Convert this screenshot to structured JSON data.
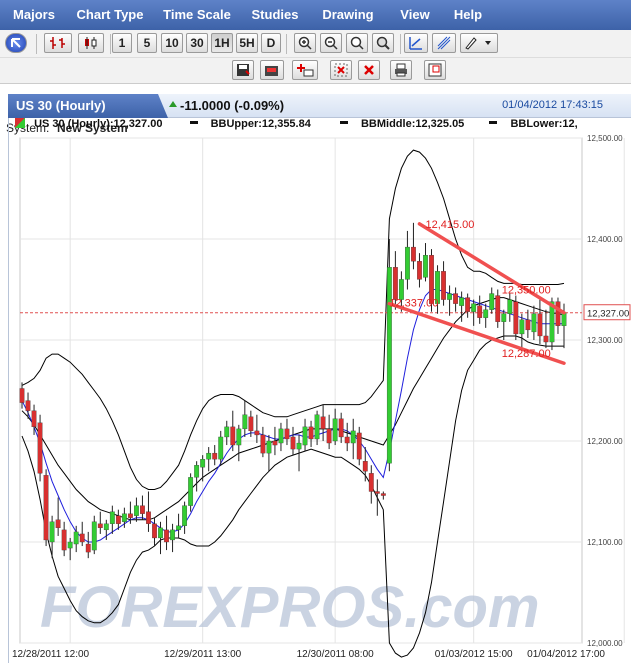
{
  "menu": [
    "Majors",
    "Chart Type",
    "Time Scale",
    "Studies",
    "Drawing",
    "View",
    "Help"
  ],
  "timescale_buttons": [
    "1",
    "5",
    "10",
    "30",
    "1H",
    "5H",
    "D"
  ],
  "timescale_selected": "1H",
  "system": {
    "label": "System:",
    "value": "New System"
  },
  "tab": {
    "title": "US 30 (Hourly)",
    "change": "-11.0000 (-0.09%)",
    "datetime": "01/04/2012 17:43:15"
  },
  "legend": {
    "price": "US 30 (Hourly):12,327.00",
    "bbupper": "BBUpper:12,355.84",
    "bbmiddle": "BBMiddle:12,325.05",
    "bblower": "BBLower:12,"
  },
  "watermark": "FOREXPROS.com",
  "colors": {
    "up": "#33cc33",
    "down": "#d83030",
    "bb": "#000000",
    "ma": "#1f1fdd",
    "trend": "#f05050",
    "text_red": "#e02020",
    "accent": "#3d62a8"
  },
  "chart_data": {
    "type": "candlestick",
    "ylim": [
      12000,
      12500
    ],
    "yticks": [
      12000,
      12100,
      12200,
      12300,
      12400,
      12500
    ],
    "ytick_labels": [
      "12,000.00",
      "12,100.00",
      "12,200.00",
      "12,300.00",
      "12,400.00",
      "12,500.00"
    ],
    "x_labels": [
      {
        "i": 8,
        "label": "12/28/2011 12:00"
      },
      {
        "i": 30,
        "label": "12/29/2011 13:00"
      },
      {
        "i": 52,
        "label": "12/30/2011 08:00"
      },
      {
        "i": 75,
        "label": "01/03/2012 15:00"
      },
      {
        "i": 100,
        "label": "01/04/2012 17:00"
      }
    ],
    "last_price": 12327,
    "last_price_label": "12,327.00",
    "candles": [
      [
        12252,
        12258,
        12232,
        12238
      ],
      [
        12240,
        12248,
        12222,
        12230
      ],
      [
        12230,
        12236,
        12206,
        12214
      ],
      [
        12218,
        12226,
        12160,
        12168
      ],
      [
        12166,
        12172,
        12096,
        12102
      ],
      [
        12100,
        12126,
        12084,
        12120
      ],
      [
        12122,
        12144,
        12106,
        12114
      ],
      [
        12112,
        12120,
        12086,
        12092
      ],
      [
        12094,
        12104,
        12082,
        12100
      ],
      [
        12098,
        12116,
        12090,
        12110
      ],
      [
        12108,
        12120,
        12096,
        12100
      ],
      [
        12098,
        12110,
        12084,
        12090
      ],
      [
        12092,
        12126,
        12088,
        12120
      ],
      [
        12118,
        12130,
        12108,
        12114
      ],
      [
        12112,
        12122,
        12102,
        12118
      ],
      [
        12118,
        12136,
        12108,
        12130
      ],
      [
        12126,
        12132,
        12112,
        12118
      ],
      [
        12120,
        12134,
        12114,
        12128
      ],
      [
        12128,
        12140,
        12118,
        12124
      ],
      [
        12126,
        12144,
        12120,
        12136
      ],
      [
        12136,
        12146,
        12122,
        12128
      ],
      [
        12130,
        12150,
        12110,
        12118
      ],
      [
        12118,
        12124,
        12096,
        12104
      ],
      [
        12104,
        12120,
        12088,
        12114
      ],
      [
        12112,
        12126,
        12092,
        12100
      ],
      [
        12102,
        12118,
        12090,
        12112
      ],
      [
        12112,
        12128,
        12104,
        12116
      ],
      [
        12116,
        12140,
        12108,
        12136
      ],
      [
        12136,
        12168,
        12130,
        12164
      ],
      [
        12164,
        12180,
        12150,
        12176
      ],
      [
        12174,
        12186,
        12160,
        12182
      ],
      [
        12182,
        12194,
        12170,
        12188
      ],
      [
        12188,
        12196,
        12176,
        12182
      ],
      [
        12182,
        12210,
        12176,
        12204
      ],
      [
        12204,
        12220,
        12196,
        12214
      ],
      [
        12214,
        12230,
        12190,
        12196
      ],
      [
        12196,
        12216,
        12180,
        12212
      ],
      [
        12212,
        12240,
        12204,
        12226
      ],
      [
        12224,
        12230,
        12204,
        12210
      ],
      [
        12210,
        12226,
        12198,
        12206
      ],
      [
        12206,
        12214,
        12184,
        12188
      ],
      [
        12188,
        12206,
        12170,
        12200
      ],
      [
        12200,
        12214,
        12186,
        12196
      ],
      [
        12198,
        12218,
        12190,
        12212
      ],
      [
        12212,
        12222,
        12196,
        12202
      ],
      [
        12204,
        12214,
        12186,
        12192
      ],
      [
        12192,
        12206,
        12170,
        12198
      ],
      [
        12196,
        12222,
        12190,
        12214
      ],
      [
        12214,
        12220,
        12194,
        12202
      ],
      [
        12202,
        12230,
        12196,
        12226
      ],
      [
        12224,
        12236,
        12200,
        12212
      ],
      [
        12212,
        12226,
        12192,
        12198
      ],
      [
        12200,
        12232,
        12196,
        12222
      ],
      [
        12222,
        12228,
        12198,
        12204
      ],
      [
        12204,
        12218,
        12190,
        12198
      ],
      [
        12198,
        12222,
        12182,
        12210
      ],
      [
        12208,
        12214,
        12176,
        12182
      ],
      [
        12180,
        12194,
        12160,
        12170
      ],
      [
        12168,
        12176,
        12138,
        12150
      ],
      [
        12150,
        12162,
        12126,
        12148
      ],
      [
        12148,
        12150,
        12142,
        12146
      ],
      [
        12178,
        12400,
        12170,
        12372
      ],
      [
        12372,
        12388,
        12330,
        12340
      ],
      [
        12340,
        12368,
        12328,
        12360
      ],
      [
        12360,
        12408,
        12350,
        12392
      ],
      [
        12392,
        12416,
        12370,
        12378
      ],
      [
        12378,
        12386,
        12352,
        12360
      ],
      [
        12362,
        12396,
        12358,
        12384
      ],
      [
        12384,
        12390,
        12328,
        12336
      ],
      [
        12336,
        12374,
        12326,
        12368
      ],
      [
        12368,
        12378,
        12334,
        12340
      ],
      [
        12340,
        12354,
        12324,
        12346
      ],
      [
        12346,
        12352,
        12328,
        12336
      ],
      [
        12334,
        12348,
        12318,
        12342
      ],
      [
        12342,
        12346,
        12322,
        12328
      ],
      [
        12328,
        12340,
        12314,
        12336
      ],
      [
        12334,
        12344,
        12316,
        12322
      ],
      [
        12322,
        12336,
        12312,
        12330
      ],
      [
        12330,
        12352,
        12326,
        12346
      ],
      [
        12344,
        12350,
        12312,
        12318
      ],
      [
        12318,
        12330,
        12300,
        12326
      ],
      [
        12326,
        12346,
        12318,
        12340
      ],
      [
        12338,
        12344,
        12300,
        12306
      ],
      [
        12306,
        12326,
        12292,
        12320
      ],
      [
        12320,
        12330,
        12302,
        12310
      ],
      [
        12308,
        12334,
        12300,
        12326
      ],
      [
        12326,
        12340,
        12296,
        12304
      ],
      [
        12304,
        12330,
        12292,
        12298
      ],
      [
        12298,
        12342,
        12290,
        12338
      ],
      [
        12338,
        12342,
        12306,
        12314
      ],
      [
        12314,
        12336,
        12292,
        12327
      ]
    ],
    "bb_upper": [
      12255,
      12258,
      12262,
      12270,
      12282,
      12286,
      12286,
      12282,
      12278,
      12272,
      12266,
      12258,
      12250,
      12242,
      12232,
      12220,
      12206,
      12190,
      12174,
      12162,
      12155,
      12152,
      12152,
      12154,
      12160,
      12168,
      12176,
      12190,
      12206,
      12220,
      12232,
      12240,
      12244,
      12246,
      12246,
      12246,
      12244,
      12240,
      12236,
      12232,
      12228,
      12226,
      12224,
      12224,
      12224,
      12226,
      12228,
      12230,
      12232,
      12234,
      12236,
      12236,
      12236,
      12236,
      12236,
      12236,
      12236,
      12238,
      12244,
      12252,
      12260,
      12420,
      12450,
      12470,
      12482,
      12488,
      12486,
      12480,
      12470,
      12456,
      12440,
      12420,
      12400,
      12384,
      12372,
      12368,
      12368,
      12366,
      12362,
      12358,
      12356,
      12356,
      12356,
      12355,
      12355,
      12355,
      12355,
      12355,
      12355,
      12355,
      12356
    ],
    "bb_middle": [
      12230,
      12224,
      12216,
      12206,
      12196,
      12186,
      12176,
      12168,
      12160,
      12152,
      12146,
      12140,
      12136,
      12132,
      12130,
      12128,
      12126,
      12124,
      12122,
      12122,
      12122,
      12122,
      12124,
      12128,
      12132,
      12136,
      12140,
      12146,
      12152,
      12158,
      12164,
      12168,
      12172,
      12176,
      12180,
      12184,
      12188,
      12190,
      12192,
      12194,
      12196,
      12198,
      12200,
      12202,
      12204,
      12206,
      12208,
      12210,
      12212,
      12212,
      12212,
      12212,
      12212,
      12210,
      12208,
      12206,
      12204,
      12202,
      12200,
      12198,
      12196,
      12206,
      12216,
      12228,
      12240,
      12252,
      12262,
      12272,
      12282,
      12292,
      12302,
      12310,
      12318,
      12324,
      12330,
      12334,
      12336,
      12338,
      12340,
      12342,
      12342,
      12340,
      12338,
      12336,
      12334,
      12332,
      12330,
      12328,
      12327,
      12326,
      12325
    ],
    "bb_lower": [
      12205,
      12190,
      12170,
      12142,
      12110,
      12086,
      12066,
      12054,
      12042,
      12032,
      12026,
      12022,
      12020,
      12020,
      12024,
      12030,
      12038,
      12054,
      12070,
      12082,
      12090,
      12092,
      12096,
      12102,
      12104,
      12104,
      12104,
      12102,
      12098,
      12096,
      12096,
      12096,
      12100,
      12106,
      12114,
      12122,
      12132,
      12140,
      12148,
      12156,
      12164,
      12170,
      12176,
      12180,
      12184,
      12186,
      12188,
      12190,
      12192,
      12190,
      12188,
      12186,
      12184,
      12184,
      12180,
      12176,
      12172,
      12166,
      12156,
      12144,
      12132,
      12000,
      11990,
      11986,
      11988,
      11995,
      12010,
      12030,
      12060,
      12100,
      12140,
      12180,
      12220,
      12250,
      12270,
      12280,
      12290,
      12296,
      12300,
      12302,
      12304,
      12304,
      12304,
      12302,
      12298,
      12296,
      12295,
      12294,
      12294,
      12294,
      12294
    ],
    "ma": [
      12240,
      12228,
      12214,
      12198,
      12178,
      12160,
      12146,
      12132,
      12120,
      12110,
      12104,
      12100,
      12100,
      12102,
      12106,
      12110,
      12114,
      12118,
      12122,
      12124,
      12124,
      12122,
      12118,
      12114,
      12110,
      12110,
      12112,
      12118,
      12128,
      12140,
      12150,
      12160,
      12168,
      12178,
      12188,
      12196,
      12202,
      12206,
      12208,
      12208,
      12206,
      12204,
      12202,
      12202,
      12204,
      12206,
      12206,
      12204,
      12204,
      12206,
      12208,
      12210,
      12212,
      12212,
      12210,
      12206,
      12200,
      12192,
      12182,
      12172,
      12164,
      12190,
      12220,
      12250,
      12282,
      12310,
      12330,
      12344,
      12350,
      12350,
      12348,
      12346,
      12344,
      12342,
      12340,
      12338,
      12336,
      12334,
      12332,
      12330,
      12328,
      12326,
      12324,
      12322,
      12320,
      12318,
      12316,
      12316,
      12316,
      12316,
      12316
    ],
    "trendlines": [
      {
        "from": [
          66,
          12415
        ],
        "to": [
          90,
          12327
        ]
      },
      {
        "from": [
          61,
          12336
        ],
        "to": [
          90,
          12277
        ]
      }
    ],
    "annotations": [
      "12,415.00",
      "12,350.00",
      "12,337.00",
      "12,287.00"
    ]
  }
}
